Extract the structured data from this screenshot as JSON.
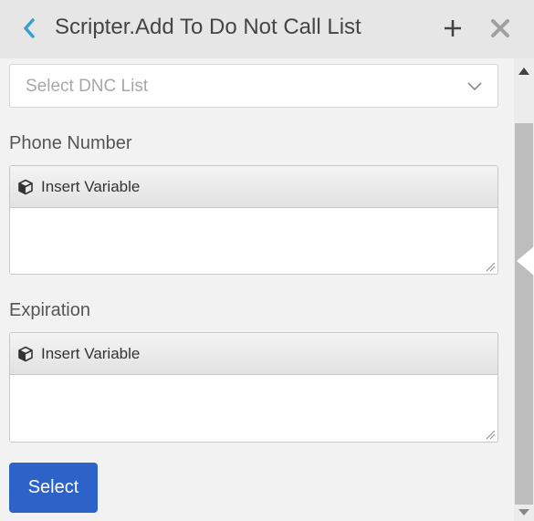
{
  "header": {
    "title": "Scripter.Add To Do Not Call List",
    "back_icon": "chevron-left-icon",
    "add_icon": "plus-icon",
    "close_icon": "close-icon",
    "accent_color": "#3a9fc9"
  },
  "form": {
    "dnc_list": {
      "placeholder": "Select DNC List",
      "chevron_icon": "chevron-down-icon"
    },
    "phone_number": {
      "label": "Phone Number",
      "insert_variable_label": "Insert Variable",
      "value": ""
    },
    "expiration": {
      "label": "Expiration",
      "insert_variable_label": "Insert Variable",
      "value": ""
    },
    "select_button_label": "Select"
  },
  "colors": {
    "primary_button": "#2d62c9",
    "background": "#f2f2f2",
    "header_background": "#e6e6e6"
  }
}
